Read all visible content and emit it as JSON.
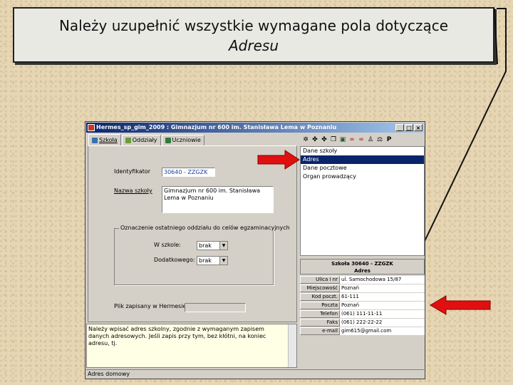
{
  "callout": {
    "line1": "Należy uzupełnić wszystkie wymagane pola dotyczące",
    "line2": "Adresu"
  },
  "window": {
    "title": "Hermes_sp_gim_2009 : Gimnazjum nr 600 im. Stanisława Lema w Poznaniu",
    "buttons": [
      "_",
      "□",
      "×"
    ],
    "tabs": [
      {
        "label": "Szkoła",
        "icon": "school-icon"
      },
      {
        "label": "Oddziały",
        "icon": "classes-icon"
      },
      {
        "label": "Uczniowie",
        "icon": "students-icon"
      }
    ],
    "status": "Adres domowy"
  },
  "form": {
    "id_label": "Identyfikator",
    "id_value": "30640 - ZZGZK",
    "name_label": "Nazwa szkoły",
    "name_value": "Gimnazjum nr 600 im. Stanisława Lema w Poznaniu",
    "group_title": "Oznaczenie ostatniego oddziału do celów egzaminacyjnych",
    "school_label": "W szkole:",
    "school_value": "brak",
    "branch_label": "Dodatkowego:",
    "branch_value": "brak",
    "file_label": "Plik zapisany w Hermesie:",
    "memo": "Należy wpisać adres szkolny, zgodnie z wymaganym zapisem danych adresowych. Jeśli zapis przy tym, bez kłótni, na koniec adresu, tj."
  },
  "toolbar": {
    "icons": [
      "gear-icon",
      "puzzle-icon",
      "puzzle-icon",
      "copy-icon",
      "save-icon",
      "binoculars-icon",
      "binoculars-icon",
      "person-icon",
      "scales-icon",
      "p-icon"
    ],
    "p_label": "P"
  },
  "list": {
    "items": [
      "Dane szkoły",
      "Adres",
      "Dane pocztowe",
      "Organ prowadzący"
    ],
    "selected": 1
  },
  "details": {
    "header1": "Szkoła 30640 - ZZGZK",
    "header2": "Adres",
    "rows": [
      {
        "label": "Ulica i nr",
        "value": "ul. Samochodowa 15/87"
      },
      {
        "label": "Miejscowość",
        "value": "Poznań"
      },
      {
        "label": "Kod poczt.",
        "value": "61-111"
      },
      {
        "label": "Poczta",
        "value": "Poznań"
      },
      {
        "label": "Telefon",
        "value": "(061) 111-11-11"
      },
      {
        "label": "Faks",
        "value": "(061) 222-22-22"
      },
      {
        "label": "e-mail",
        "value": "gim615@gmail.com"
      }
    ]
  },
  "colors": {
    "accent_arrow": "#e01010",
    "title_blue": "#0a246a",
    "selection": "#0a246a"
  }
}
